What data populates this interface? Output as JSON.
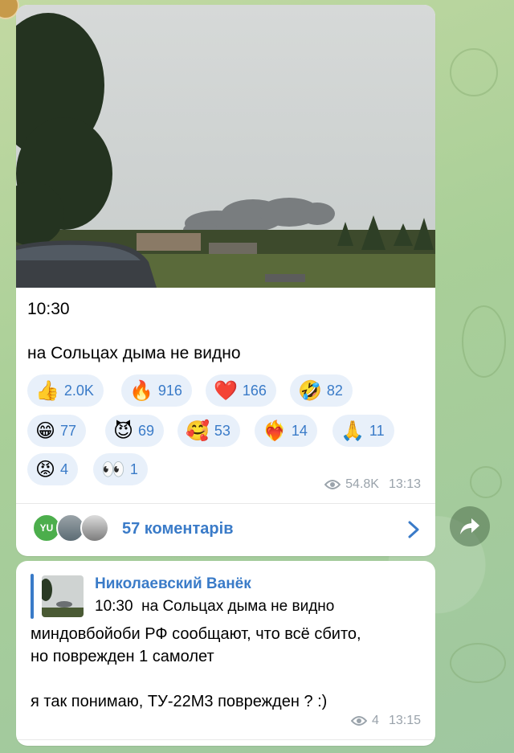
{
  "post": {
    "time_text": "10:30",
    "caption": "на Сольцах дыма не видно",
    "reactions": [
      {
        "emoji": "👍",
        "count": "2.0K"
      },
      {
        "emoji": "🔥",
        "count": "916"
      },
      {
        "emoji": "❤️",
        "count": "166"
      },
      {
        "emoji": "🤣",
        "count": "82"
      },
      {
        "emoji": "😁",
        "count": "77"
      },
      {
        "emoji": "😈",
        "count": "69"
      },
      {
        "emoji": "🥰",
        "count": "53"
      },
      {
        "emoji": "❤️‍🔥",
        "count": "14"
      },
      {
        "emoji": "🙏",
        "count": "11"
      },
      {
        "emoji": "😡",
        "count": "4"
      },
      {
        "emoji": "👀",
        "count": "1"
      }
    ],
    "views": "54.8K",
    "timestamp": "13:13",
    "comments": {
      "avatar_initials": "YU",
      "label": "57 коментарів"
    }
  },
  "reply_message": {
    "quoted_author": "Николаевский Ванёк",
    "quoted_text": "10:30  на Сольцах дыма не видно",
    "lines": [
      "миндовбойоби РФ сообщают, что всё сбито,",
      "но поврежден 1 самолет",
      "я так понимаю, ТУ-22М3 поврежден ? :)"
    ],
    "views": "4",
    "timestamp": "13:15"
  },
  "icons": {
    "views": "eye-icon",
    "share": "share-arrow-icon",
    "open_comments": "chevron-right-icon"
  },
  "colors": {
    "accent": "#3a7bc8",
    "reaction_bg": "#e8f0fa",
    "meta": "#9aa3ab"
  }
}
